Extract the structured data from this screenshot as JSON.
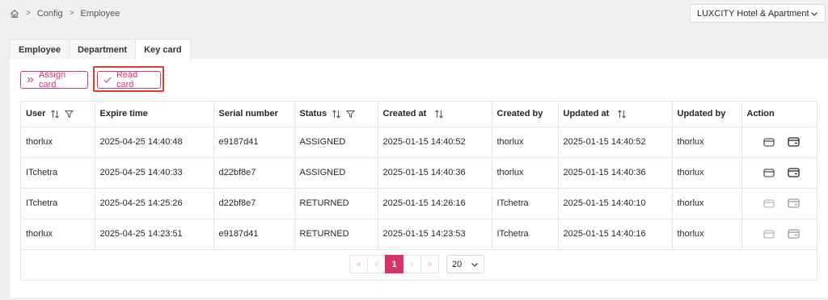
{
  "breadcrumb": [
    "Config",
    "Employee"
  ],
  "hotel_select": {
    "value": "LUXCITY Hotel & Apartment"
  },
  "tabs": [
    {
      "label": "Employee",
      "active": false
    },
    {
      "label": "Department",
      "active": false
    },
    {
      "label": "Key card",
      "active": true
    }
  ],
  "toolbar": {
    "assign_label": "Assign card",
    "read_label": "Read card"
  },
  "table": {
    "columns": [
      "User",
      "Expire time",
      "Serial number",
      "Status",
      "Created at",
      "Created by",
      "Updated at",
      "Updated by",
      "Action"
    ],
    "rows": [
      {
        "user": "thorlux",
        "expire": "2025-04-25 14:40:48",
        "serial": "e9187d41",
        "status": "ASSIGNED",
        "created_at": "2025-01-15 14:40:52",
        "created_by": "thorlux",
        "updated_at": "2025-01-15 14:40:52",
        "updated_by": "thorlux",
        "enabled": true
      },
      {
        "user": "ITchetra",
        "expire": "2025-04-25 14:40:33",
        "serial": "d22bf8e7",
        "status": "ASSIGNED",
        "created_at": "2025-01-15 14:40:36",
        "created_by": "thorlux",
        "updated_at": "2025-01-15 14:40:36",
        "updated_by": "thorlux",
        "enabled": true
      },
      {
        "user": "ITchetra",
        "expire": "2025-04-25 14:25:26",
        "serial": "d22bf8e7",
        "status": "RETURNED",
        "created_at": "2025-01-15 14:26:16",
        "created_by": "ITchetra",
        "updated_at": "2025-01-15 14:40:10",
        "updated_by": "thorlux",
        "enabled": false
      },
      {
        "user": "thorlux",
        "expire": "2025-04-25 14:23:51",
        "serial": "e9187d41",
        "status": "RETURNED",
        "created_at": "2025-01-15 14:23:53",
        "created_by": "ITchetra",
        "updated_at": "2025-01-15 14:40:16",
        "updated_by": "thorlux",
        "enabled": false
      }
    ]
  },
  "pagination": {
    "first": "«",
    "prev": "‹",
    "current": "1",
    "next": "›",
    "last": "»",
    "page_size": "20"
  },
  "icons": {
    "home": "home-icon",
    "sort": "sort-icon",
    "filter": "filter-icon",
    "card": "card-icon",
    "card_return": "card-return-icon"
  },
  "colors": {
    "accent": "#d6336c",
    "focus": "#e03a2f"
  }
}
